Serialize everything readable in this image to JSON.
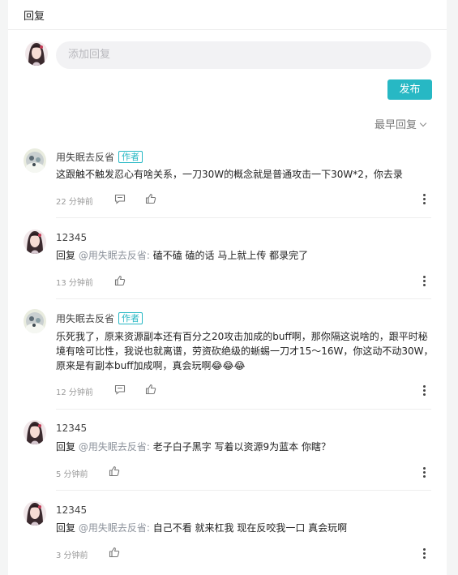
{
  "header": {
    "title": "回复"
  },
  "composer": {
    "placeholder": "添加回复",
    "publish_label": "发布",
    "sort_label": "最早回复"
  },
  "author_tag": "作者",
  "comments": [
    {
      "user": "用失眠去反省",
      "is_author": true,
      "text": "这跟触不触发忍心有啥关系，一刀30W的概念就是普通攻击一下30W*2，你去录",
      "time": "22 分钟前",
      "has_reply_icon": true
    },
    {
      "user": "12345",
      "is_author": false,
      "reply_prefix": "回复",
      "reply_to": "@用失眠去反省:",
      "text": " 磕不磕 磕的话 马上就上传 都录完了",
      "time": "13 分钟前",
      "has_reply_icon": false
    },
    {
      "user": "用失眠去反省",
      "is_author": true,
      "text": "乐死我了，原来资源副本还有百分之20攻击加成的buff啊，那你隔这说啥的，跟平时秘境有啥可比性，我说也就离谱，劳资砍绝级的蜥蜴一刀才15～16W，你这动不动30W，原来是有副本buff加成啊，真会玩啊😂😂😂",
      "time": "12 分钟前",
      "has_reply_icon": true
    },
    {
      "user": "12345",
      "is_author": false,
      "reply_prefix": "回复",
      "reply_to": "@用失眠去反省:",
      "text": " 老子白子黑字 写着以资源9为蓝本 你瞎？",
      "time": "5 分钟前",
      "has_reply_icon": false
    },
    {
      "user": "12345",
      "is_author": false,
      "reply_prefix": "回复",
      "reply_to": "@用失眠去反省:",
      "text": " 自己不看 就来杠我 现在反咬我一口 真会玩啊",
      "time": "3 分钟前",
      "has_reply_icon": false
    }
  ],
  "icons": {
    "reply": "comment-icon",
    "like": "thumb-up-icon",
    "more": "more-vertical-icon",
    "sort": "chevron-down-icon"
  },
  "colors": {
    "accent": "#27b8c4",
    "background": "#f4f5f5",
    "input_background": "#f2f2f4"
  }
}
